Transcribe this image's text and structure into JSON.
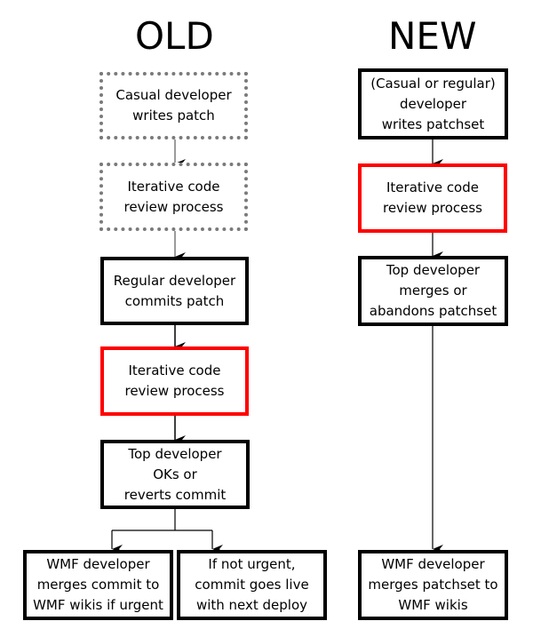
{
  "columns": {
    "old": {
      "title": "OLD",
      "steps": [
        {
          "text": "Casual developer\nwrites patch",
          "style": "dotted"
        },
        {
          "text": "Iterative code\nreview process",
          "style": "dotted"
        },
        {
          "text": "Regular developer\ncommits patch",
          "style": "solid"
        },
        {
          "text": "Iterative code\nreview process",
          "style": "highlight"
        },
        {
          "text": "Top developer\nOKs or\nreverts commit",
          "style": "solid"
        }
      ],
      "branches": [
        {
          "text": "WMF developer\nmerges commit to\nWMF wikis if urgent",
          "style": "solid"
        },
        {
          "text": "If not urgent,\ncommit goes live\nwith next deploy",
          "style": "solid"
        }
      ]
    },
    "new": {
      "title": "NEW",
      "steps": [
        {
          "text": "(Casual or regular)\ndeveloper\nwrites patchset",
          "style": "solid"
        },
        {
          "text": "Iterative code\nreview process",
          "style": "highlight"
        },
        {
          "text": "Top developer\nmerges or\nabandons patchset",
          "style": "solid"
        },
        {
          "text": "WMF developer\nmerges patchset to\nWMF wikis",
          "style": "solid"
        }
      ]
    }
  },
  "colors": {
    "highlight": "#ff0000",
    "dotted_border": "#7a7a7a",
    "solid_border": "#000000"
  }
}
